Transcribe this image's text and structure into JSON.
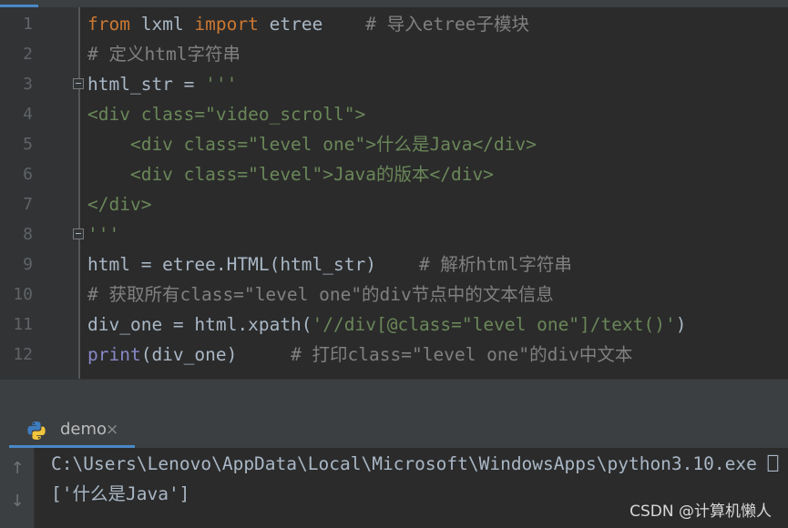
{
  "editor": {
    "line_numbers": [
      "1",
      "2",
      "3",
      "4",
      "5",
      "6",
      "7",
      "8",
      "9",
      "10",
      "11",
      "12"
    ],
    "lines": [
      [
        {
          "t": "from",
          "c": "kw"
        },
        {
          "t": " lxml ",
          "c": ""
        },
        {
          "t": "import",
          "c": "kw"
        },
        {
          "t": " etree    ",
          "c": ""
        },
        {
          "t": "# 导入etree子模块",
          "c": "cm"
        }
      ],
      [
        {
          "t": "# 定义html字符串",
          "c": "cm"
        }
      ],
      [
        {
          "t": "html_str = ",
          "c": ""
        },
        {
          "t": "'''",
          "c": "str"
        }
      ],
      [
        {
          "t": "<div class=\"video_scroll\">",
          "c": "str"
        }
      ],
      [
        {
          "t": "    <div class=\"level one\">什么是Java</div>",
          "c": "str"
        }
      ],
      [
        {
          "t": "    <div class=\"level\">Java的版本</div>",
          "c": "str"
        }
      ],
      [
        {
          "t": "</div>",
          "c": "str"
        }
      ],
      [
        {
          "t": "'''",
          "c": "str"
        }
      ],
      [
        {
          "t": "html = etree.HTML(html_str)    ",
          "c": ""
        },
        {
          "t": "# 解析html字符串",
          "c": "cm"
        }
      ],
      [
        {
          "t": "# 获取所有class=\"level one\"的div节点中的文本信息",
          "c": "cm"
        }
      ],
      [
        {
          "t": "div_one = html.xpath(",
          "c": ""
        },
        {
          "t": "'//div[@class=\"level one\"]/text()'",
          "c": "str"
        },
        {
          "t": ")",
          "c": ""
        }
      ],
      [
        {
          "t": "print",
          "c": "fn"
        },
        {
          "t": "(div_one)     ",
          "c": ""
        },
        {
          "t": "# 打印class=\"level one\"的div中文本",
          "c": "cm"
        }
      ]
    ]
  },
  "run_panel": {
    "tab_label": "demo",
    "tab_close": "×",
    "tab_icon": "python-icon",
    "scroll_up": "↑",
    "scroll_down": "↓",
    "output": [
      "C:\\Users\\Lenovo\\AppData\\Local\\Microsoft\\WindowsApps\\python3.10.exe ⎕",
      "['什么是Java']"
    ]
  },
  "watermark": "CSDN @计算机懒人",
  "colors": {
    "keyword": "#cc7832",
    "string": "#6a8759",
    "comment": "#808080",
    "builtin": "#8888c6",
    "text": "#a9b7c6",
    "accent": "#4a88c7"
  }
}
